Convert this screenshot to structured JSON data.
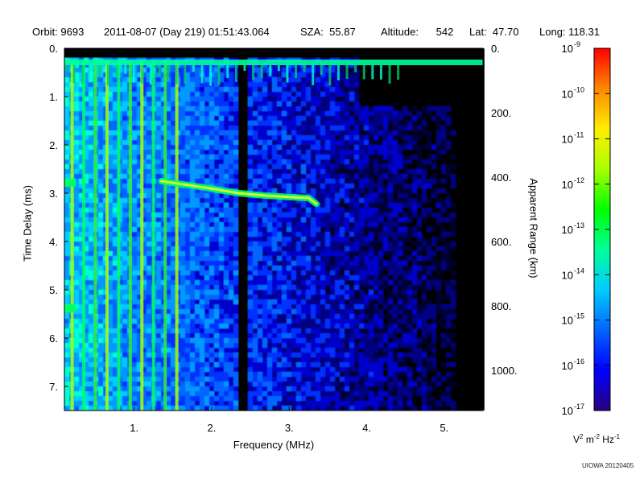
{
  "header": {
    "orbit_label": "Orbit:",
    "orbit": "9693",
    "datetime": "2011-08-07 (Day 219) 01:51:43.064",
    "sza_label": "SZA:",
    "sza": "55.87",
    "altitude_label": "Altitude:",
    "altitude": "542",
    "lat_label": "Lat:",
    "lat": "47.70",
    "long_label": "Long:",
    "long": "118.31"
  },
  "axes": {
    "x_label": "Frequency (MHz)",
    "y_label": "Time Delay (ms)",
    "y2_label": "Apparent Range (km)"
  },
  "colorbar": {
    "units_prefix": "V",
    "units_m": "m",
    "units_hz": "Hz",
    "units_exp": "-1",
    "units_exp2": "2",
    "units_expm2": "-2",
    "credit": "UIOWA 20120405",
    "ticks": [
      {
        "base": "10",
        "exp": "-9",
        "value": -9
      },
      {
        "base": "10",
        "exp": "-10",
        "value": -10
      },
      {
        "base": "10",
        "exp": "-11",
        "value": -11
      },
      {
        "base": "10",
        "exp": "-12",
        "value": -12
      },
      {
        "base": "10",
        "exp": "-13",
        "value": -13
      },
      {
        "base": "10",
        "exp": "-14",
        "value": -14
      },
      {
        "base": "10",
        "exp": "-15",
        "value": -15
      },
      {
        "base": "10",
        "exp": "-16",
        "value": -16
      },
      {
        "base": "10",
        "exp": "-17",
        "value": -17
      }
    ],
    "colors": [
      "#2a0080",
      "#0000ff",
      "#0066ff",
      "#00ccff",
      "#00ff99",
      "#00ff00",
      "#aaff00",
      "#ffee00",
      "#ff8800",
      "#ff0000"
    ]
  },
  "chart_data": {
    "type": "heatmap",
    "title": "",
    "xlabel": "Frequency (MHz)",
    "ylabel": "Time Delay (ms)",
    "y2label": "Apparent Range (km)",
    "xlim": [
      0.1,
      5.5
    ],
    "ylim": [
      7.5,
      0
    ],
    "y2lim": [
      0,
      1125
    ],
    "x_ticks": [
      {
        "value": 1,
        "label": "1."
      },
      {
        "value": 2,
        "label": "2."
      },
      {
        "value": 3,
        "label": "3."
      },
      {
        "value": 4,
        "label": "4."
      },
      {
        "value": 5,
        "label": "5."
      }
    ],
    "y_ticks": [
      {
        "value": 0,
        "label": "0."
      },
      {
        "value": 1,
        "label": "1."
      },
      {
        "value": 2,
        "label": "2."
      },
      {
        "value": 3,
        "label": "3."
      },
      {
        "value": 4,
        "label": "4."
      },
      {
        "value": 5,
        "label": "5."
      },
      {
        "value": 6,
        "label": "6."
      },
      {
        "value": 7,
        "label": "7."
      }
    ],
    "y2_ticks": [
      {
        "value": 0,
        "label": "0."
      },
      {
        "value": 200,
        "label": "200."
      },
      {
        "value": 400,
        "label": "400."
      },
      {
        "value": 600,
        "label": "600."
      },
      {
        "value": 800,
        "label": "800."
      },
      {
        "value": 1000,
        "label": "1000."
      }
    ],
    "colorbar_range_log10": [
      -17,
      -9
    ],
    "colorbar_units": "V^2 m^-2 Hz^-1",
    "features": {
      "surface_echo_trace": [
        {
          "f": 1.35,
          "t": 2.75
        },
        {
          "f": 1.9,
          "t": 2.88
        },
        {
          "f": 2.35,
          "t": 3.0
        },
        {
          "f": 2.7,
          "t": 3.05
        },
        {
          "f": 3.0,
          "t": 3.08
        },
        {
          "f": 3.25,
          "t": 3.1
        },
        {
          "f": 3.35,
          "t": 3.22
        }
      ],
      "vertical_harmonic_lines_mhz": [
        0.2,
        0.35,
        0.5,
        0.65,
        0.8,
        0.95,
        1.1,
        1.25,
        1.4,
        1.55
      ],
      "plasma_band_delay_ms": 0.3,
      "dark_gap_frequency_mhz": 2.38
    }
  }
}
